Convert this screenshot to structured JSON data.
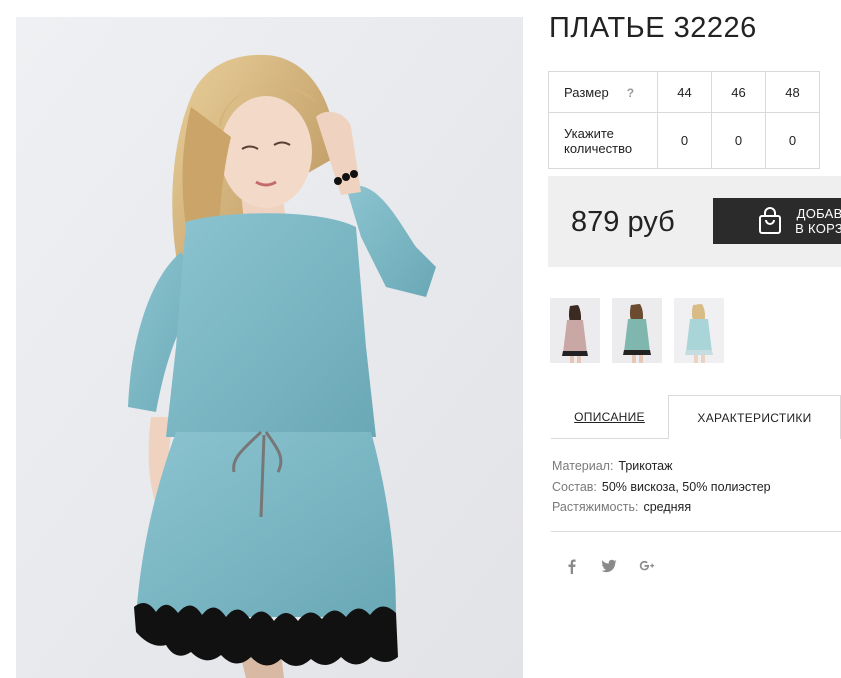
{
  "product": {
    "title": "ПЛАТЬЕ 32226",
    "image_alt": "Голубое платье с кружевом"
  },
  "sizes": {
    "size_label": "Размер",
    "help_icon": "?",
    "qty_label": "Укажите количество",
    "columns": [
      "44",
      "46",
      "48"
    ],
    "quantities": [
      "0",
      "0",
      "0"
    ]
  },
  "price": {
    "value": "879 руб",
    "cart_button_label": "ДОБАВИТЬ В КОРЗИНУ",
    "cart_icon": "shopping-bag-icon"
  },
  "thumbnails": [
    {
      "name": "thumb-pink-dress",
      "color": "#c9a7a5"
    },
    {
      "name": "thumb-teal-dress",
      "color": "#7fb6ad"
    },
    {
      "name": "thumb-blue-dress",
      "color": "#a9d4d8"
    }
  ],
  "tabs": {
    "description": "ОПИСАНИЕ",
    "characteristics": "ХАРАКТЕРИСТИКИ",
    "active": "characteristics"
  },
  "specs": [
    {
      "key": "Материал:",
      "value": "Трикотаж"
    },
    {
      "key": "Состав:",
      "value": "50% вискоза, 50% полиэстер"
    },
    {
      "key": "Растяжимость:",
      "value": "средняя"
    }
  ],
  "social": [
    "facebook-icon",
    "twitter-icon",
    "google-plus-icon"
  ],
  "colors": {
    "dress": "#78b5c3",
    "lace": "#111111",
    "button_bg": "#2b2b2b",
    "price_bg": "#efefef"
  }
}
